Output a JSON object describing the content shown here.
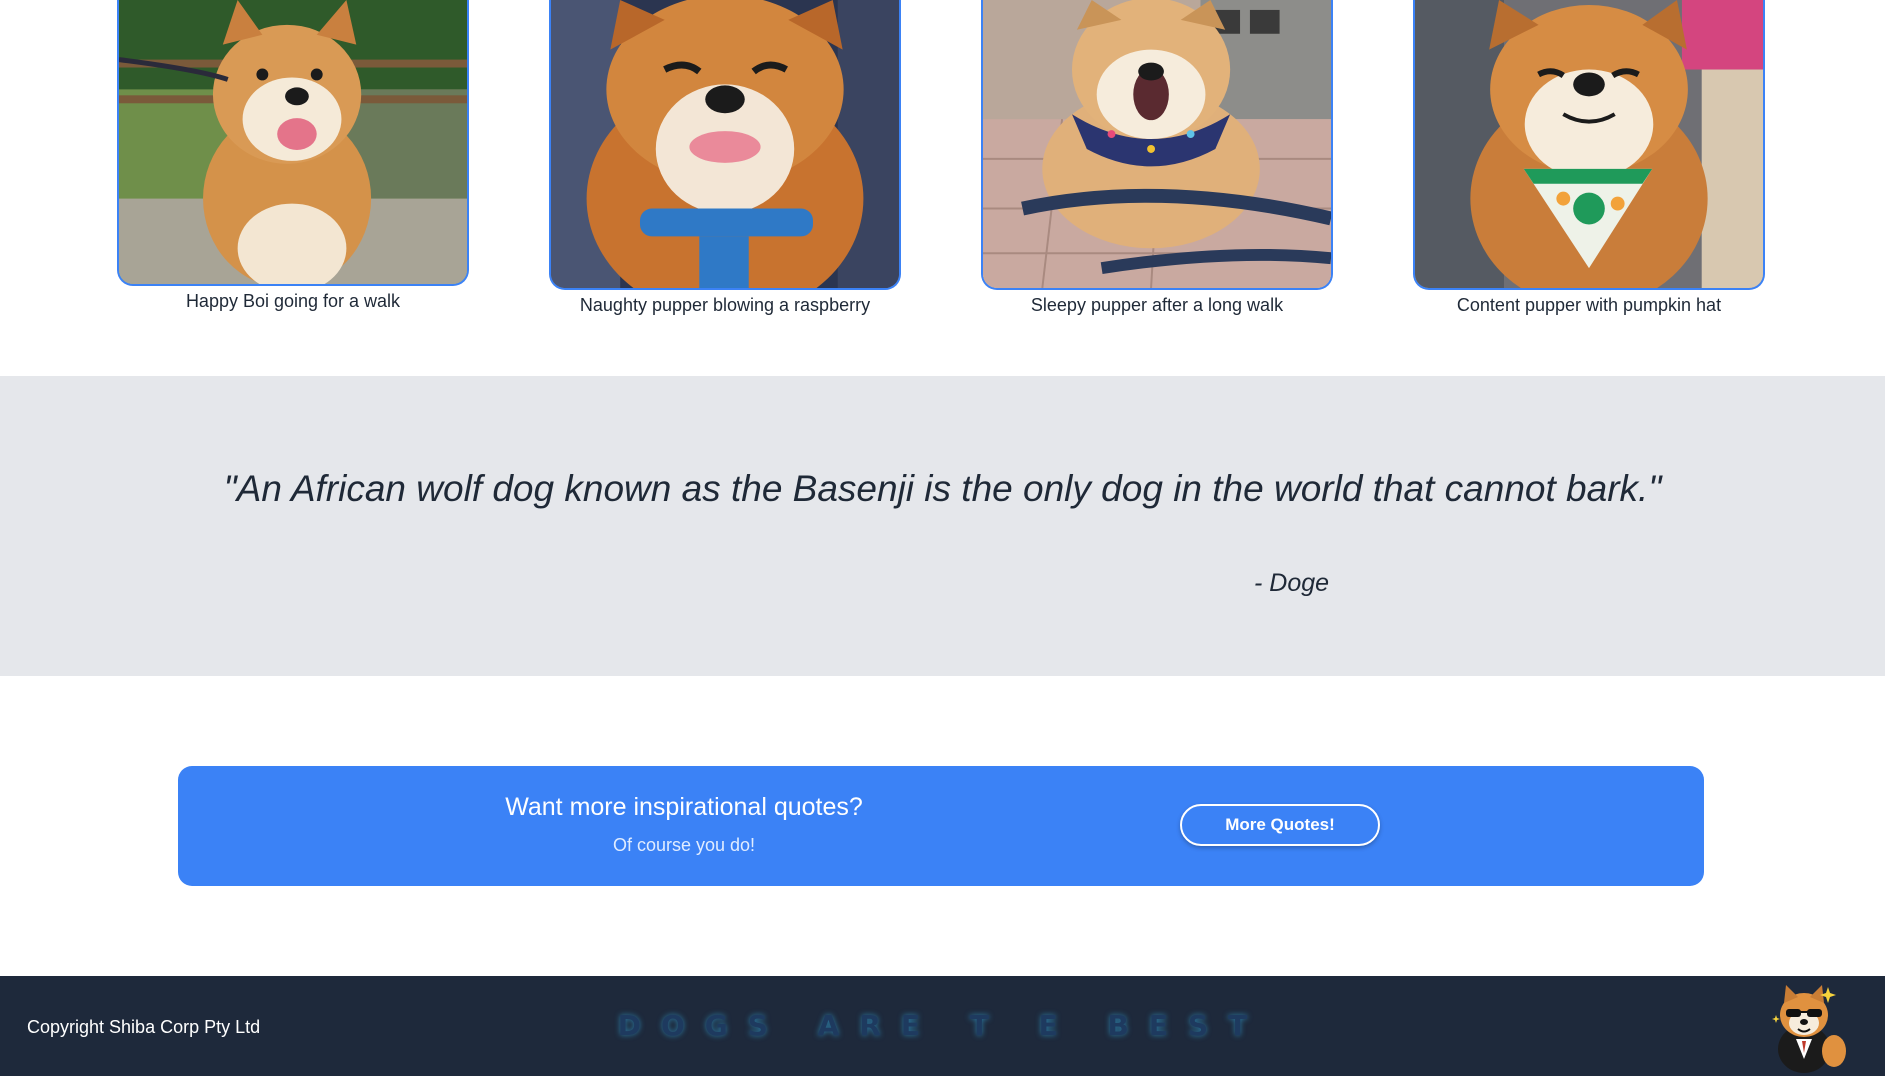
{
  "gallery": {
    "items": [
      {
        "caption": "Happy Boi going for a walk"
      },
      {
        "caption": "Naughty pupper blowing a raspberry"
      },
      {
        "caption": "Sleepy pupper after a long walk"
      },
      {
        "caption": "Content pupper with pumpkin hat"
      }
    ]
  },
  "quote": {
    "text": "\"An African wolf dog known as the Basenji is the only dog in the world that cannot bark.\"",
    "author": "- Doge"
  },
  "cta": {
    "heading": "Want more inspirational quotes?",
    "subheading": "Of course you do!",
    "button_label": "More Quotes!"
  },
  "footer": {
    "copyright": "Copyright Shiba Corp Pty Ltd",
    "tagline": "DOGS ARE T E BEST"
  },
  "colors": {
    "accent": "#3b82f6",
    "quote_band": "#e5e7eb",
    "footer_bg": "#1e293b"
  }
}
